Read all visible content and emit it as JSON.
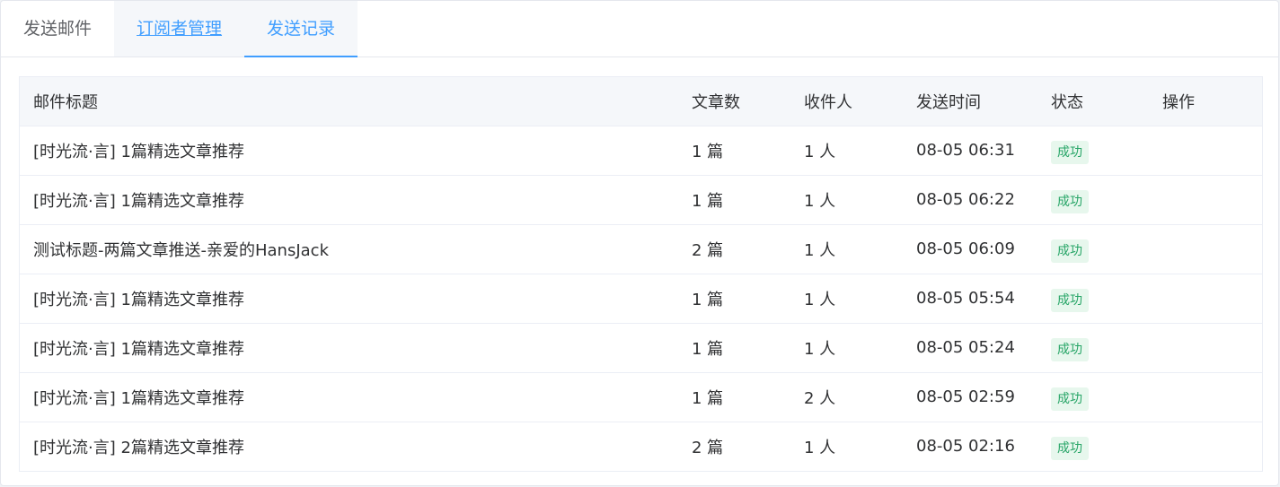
{
  "tabs": [
    {
      "label": "发送邮件"
    },
    {
      "label": "订阅者管理"
    },
    {
      "label": "发送记录"
    }
  ],
  "active_tab": 2,
  "table": {
    "headers": {
      "title": "邮件标题",
      "articles": "文章数",
      "recipients": "收件人",
      "sent_time": "发送时间",
      "status": "状态",
      "actions": "操作"
    },
    "rows": [
      {
        "title": "[时光流·言] 1篇精选文章推荐",
        "articles": "1 篇",
        "recipients": "1 人",
        "sent_time": "08-05 06:31",
        "status": "成功"
      },
      {
        "title": "[时光流·言] 1篇精选文章推荐",
        "articles": "1 篇",
        "recipients": "1 人",
        "sent_time": "08-05 06:22",
        "status": "成功"
      },
      {
        "title": "测试标题-两篇文章推送-亲爱的HansJack",
        "articles": "2 篇",
        "recipients": "1 人",
        "sent_time": "08-05 06:09",
        "status": "成功"
      },
      {
        "title": "[时光流·言] 1篇精选文章推荐",
        "articles": "1 篇",
        "recipients": "1 人",
        "sent_time": "08-05 05:54",
        "status": "成功"
      },
      {
        "title": "[时光流·言] 1篇精选文章推荐",
        "articles": "1 篇",
        "recipients": "1 人",
        "sent_time": "08-05 05:24",
        "status": "成功"
      },
      {
        "title": "[时光流·言] 1篇精选文章推荐",
        "articles": "1 篇",
        "recipients": "2 人",
        "sent_time": "08-05 02:59",
        "status": "成功"
      },
      {
        "title": "[时光流·言] 2篇精选文章推荐",
        "articles": "2 篇",
        "recipients": "1 人",
        "sent_time": "08-05 02:16",
        "status": "成功"
      }
    ]
  },
  "colors": {
    "accent": "#409eff",
    "success_bg": "#e7f7ed",
    "success_text": "#27a567",
    "header_bg": "#f5f7fa",
    "border": "#ebeef5"
  }
}
